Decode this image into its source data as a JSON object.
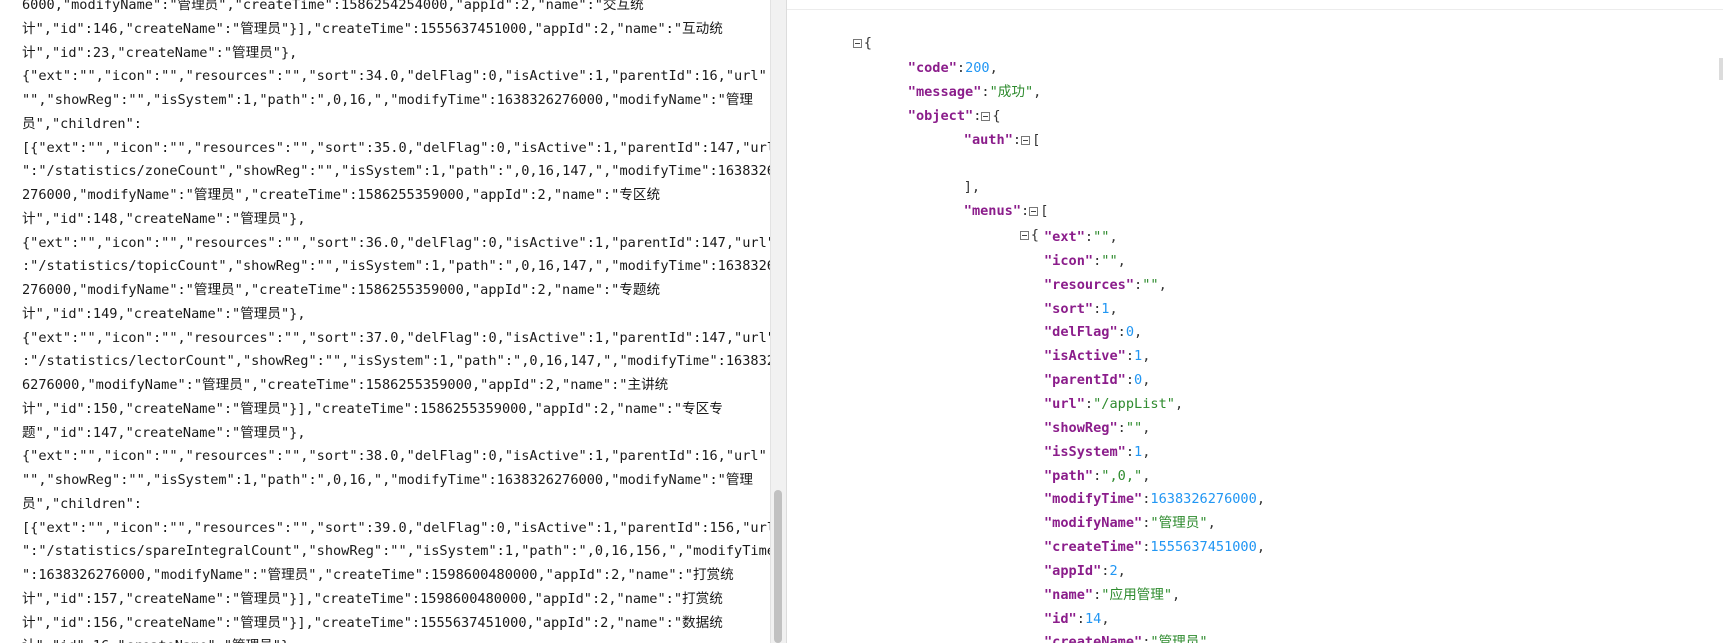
{
  "raw_lines": [
    "6000,\"modifyName\":\"管理员\",\"createTime\":1586254254000,\"appId\":2,\"name\":\"交互统",
    "计\",\"id\":146,\"createName\":\"管理员\"}],\"createTime\":1555637451000,\"appId\":2,\"name\":\"互动统",
    "计\",\"id\":23,\"createName\":\"管理员\"},",
    "{\"ext\":\"\",\"icon\":\"\",\"resources\":\"\",\"sort\":34.0,\"delFlag\":0,\"isActive\":1,\"parentId\":16,\"url\":",
    "\"\",\"showReg\":\"\",\"isSystem\":1,\"path\":\",0,16,\",\"modifyTime\":1638326276000,\"modifyName\":\"管理",
    "员\",\"children\":",
    "[{\"ext\":\"\",\"icon\":\"\",\"resources\":\"\",\"sort\":35.0,\"delFlag\":0,\"isActive\":1,\"parentId\":147,\"url",
    "\":\"/statistics/zoneCount\",\"showReg\":\"\",\"isSystem\":1,\"path\":\",0,16,147,\",\"modifyTime\":1638326",
    "276000,\"modifyName\":\"管理员\",\"createTime\":1586255359000,\"appId\":2,\"name\":\"专区统",
    "计\",\"id\":148,\"createName\":\"管理员\"},",
    "{\"ext\":\"\",\"icon\":\"\",\"resources\":\"\",\"sort\":36.0,\"delFlag\":0,\"isActive\":1,\"parentId\":147,\"url\"",
    ":\"/statistics/topicCount\",\"showReg\":\"\",\"isSystem\":1,\"path\":\",0,16,147,\",\"modifyTime\":1638326",
    "276000,\"modifyName\":\"管理员\",\"createTime\":1586255359000,\"appId\":2,\"name\":\"专题统",
    "计\",\"id\":149,\"createName\":\"管理员\"},",
    "{\"ext\":\"\",\"icon\":\"\",\"resources\":\"\",\"sort\":37.0,\"delFlag\":0,\"isActive\":1,\"parentId\":147,\"url\"",
    ":\"/statistics/lectorCount\",\"showReg\":\"\",\"isSystem\":1,\"path\":\",0,16,147,\",\"modifyTime\":163832",
    "6276000,\"modifyName\":\"管理员\",\"createTime\":1586255359000,\"appId\":2,\"name\":\"主讲统",
    "计\",\"id\":150,\"createName\":\"管理员\"}],\"createTime\":1586255359000,\"appId\":2,\"name\":\"专区专",
    "题\",\"id\":147,\"createName\":\"管理员\"},",
    "{\"ext\":\"\",\"icon\":\"\",\"resources\":\"\",\"sort\":38.0,\"delFlag\":0,\"isActive\":1,\"parentId\":16,\"url\":",
    "\"\",\"showReg\":\"\",\"isSystem\":1,\"path\":\",0,16,\",\"modifyTime\":1638326276000,\"modifyName\":\"管理",
    "员\",\"children\":",
    "[{\"ext\":\"\",\"icon\":\"\",\"resources\":\"\",\"sort\":39.0,\"delFlag\":0,\"isActive\":1,\"parentId\":156,\"url",
    "\":\"/statistics/spareIntegralCount\",\"showReg\":\"\",\"isSystem\":1,\"path\":\",0,16,156,\",\"modifyTime",
    "\":1638326276000,\"modifyName\":\"管理员\",\"createTime\":1598600480000,\"appId\":2,\"name\":\"打赏统",
    "计\",\"id\":157,\"createName\":\"管理员\"}],\"createTime\":1598600480000,\"appId\":2,\"name\":\"打赏统",
    "计\",\"id\":156,\"createName\":\"管理员\"}],\"createTime\":1555637451000,\"appId\":2,\"name\":\"数据统",
    "计\",\"id\":16,\"createName\":\"管理员\"},"
  ],
  "viewer": {
    "root_open": "{",
    "code_key": "code",
    "code_val": "200",
    "message_key": "message",
    "message_val": "成功",
    "object_key": "object",
    "object_open": "{",
    "auth_key": "auth",
    "auth_open": "[",
    "auth_close": "],",
    "menus_key": "menus",
    "menus_open": "[",
    "item_open": "{",
    "fields": [
      {
        "key": "ext",
        "val": "",
        "type": "str"
      },
      {
        "key": "icon",
        "val": "",
        "type": "str"
      },
      {
        "key": "resources",
        "val": "",
        "type": "str"
      },
      {
        "key": "sort",
        "val": "1",
        "type": "num"
      },
      {
        "key": "delFlag",
        "val": "0",
        "type": "num"
      },
      {
        "key": "isActive",
        "val": "1",
        "type": "num"
      },
      {
        "key": "parentId",
        "val": "0",
        "type": "num"
      },
      {
        "key": "url",
        "val": "/appList",
        "type": "str"
      },
      {
        "key": "showReg",
        "val": "",
        "type": "str"
      },
      {
        "key": "isSystem",
        "val": "1",
        "type": "num"
      },
      {
        "key": "path",
        "val": ",0,",
        "type": "str"
      },
      {
        "key": "modifyTime",
        "val": "1638326276000",
        "type": "num"
      },
      {
        "key": "modifyName",
        "val": "管理员",
        "type": "str"
      },
      {
        "key": "createTime",
        "val": "1555637451000",
        "type": "num"
      },
      {
        "key": "appId",
        "val": "2",
        "type": "num"
      },
      {
        "key": "name",
        "val": "应用管理",
        "type": "str"
      },
      {
        "key": "id",
        "val": "14",
        "type": "num"
      },
      {
        "key": "createName",
        "val": "管理员",
        "type": "str"
      }
    ]
  },
  "colors": {
    "key": "#8b1d8b",
    "string": "#2e8b2e",
    "number": "#2196f3"
  }
}
